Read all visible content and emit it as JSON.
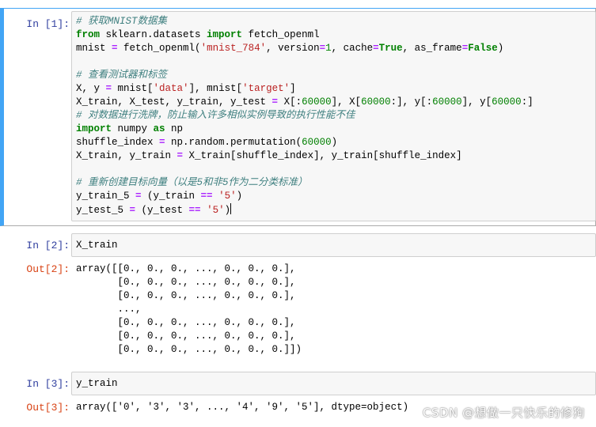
{
  "cells": [
    {
      "prompt": "In  [1]:",
      "lines": [
        [
          {
            "t": "cm",
            "v": "# 获取MNIST数据集"
          }
        ],
        [
          {
            "t": "kw",
            "v": "from"
          },
          {
            "t": "",
            "v": " sklearn.datasets "
          },
          {
            "t": "kw",
            "v": "import"
          },
          {
            "t": "",
            "v": " fetch_openml"
          }
        ],
        [
          {
            "t": "",
            "v": "mnist "
          },
          {
            "t": "op",
            "v": "="
          },
          {
            "t": "",
            "v": " fetch_openml("
          },
          {
            "t": "str",
            "v": "'mnist_784'"
          },
          {
            "t": "",
            "v": ", version"
          },
          {
            "t": "op",
            "v": "="
          },
          {
            "t": "num",
            "v": "1"
          },
          {
            "t": "",
            "v": ", cache"
          },
          {
            "t": "op",
            "v": "="
          },
          {
            "t": "kw",
            "v": "True"
          },
          {
            "t": "",
            "v": ", as_frame"
          },
          {
            "t": "op",
            "v": "="
          },
          {
            "t": "kw",
            "v": "False"
          },
          {
            "t": "",
            "v": ")"
          }
        ],
        [],
        [
          {
            "t": "cm",
            "v": "# 查看测试器和标签"
          }
        ],
        [
          {
            "t": "",
            "v": "X, y "
          },
          {
            "t": "op",
            "v": "="
          },
          {
            "t": "",
            "v": " mnist["
          },
          {
            "t": "str",
            "v": "'data'"
          },
          {
            "t": "",
            "v": "], mnist["
          },
          {
            "t": "str",
            "v": "'target'"
          },
          {
            "t": "",
            "v": "]"
          }
        ],
        [
          {
            "t": "",
            "v": "X_train, X_test, y_train, y_test "
          },
          {
            "t": "op",
            "v": "="
          },
          {
            "t": "",
            "v": " X[:"
          },
          {
            "t": "num",
            "v": "60000"
          },
          {
            "t": "",
            "v": "], X["
          },
          {
            "t": "num",
            "v": "60000"
          },
          {
            "t": "",
            "v": ":], y[:"
          },
          {
            "t": "num",
            "v": "60000"
          },
          {
            "t": "",
            "v": "], y["
          },
          {
            "t": "num",
            "v": "60000"
          },
          {
            "t": "",
            "v": ":]"
          }
        ],
        [
          {
            "t": "cm",
            "v": "# 对数据进行洗牌，防止输入许多相似实例导致的执行性能不佳"
          }
        ],
        [
          {
            "t": "kw",
            "v": "import"
          },
          {
            "t": "",
            "v": " numpy "
          },
          {
            "t": "kw",
            "v": "as"
          },
          {
            "t": "",
            "v": " np"
          }
        ],
        [
          {
            "t": "",
            "v": "shuffle_index "
          },
          {
            "t": "op",
            "v": "="
          },
          {
            "t": "",
            "v": " np.random.permutation("
          },
          {
            "t": "num",
            "v": "60000"
          },
          {
            "t": "",
            "v": ")"
          }
        ],
        [
          {
            "t": "",
            "v": "X_train, y_train "
          },
          {
            "t": "op",
            "v": "="
          },
          {
            "t": "",
            "v": " X_train[shuffle_index], y_train[shuffle_index]"
          }
        ],
        [],
        [
          {
            "t": "cm",
            "v": "# 重新创建目标向量（以是5和非5作为二分类标准）"
          }
        ],
        [
          {
            "t": "",
            "v": "y_train_5 "
          },
          {
            "t": "op",
            "v": "="
          },
          {
            "t": "",
            "v": " (y_train "
          },
          {
            "t": "op",
            "v": "=="
          },
          {
            "t": "",
            "v": " "
          },
          {
            "t": "str",
            "v": "'5'"
          },
          {
            "t": "",
            "v": ")"
          }
        ],
        [
          {
            "t": "",
            "v": "y_test_5 "
          },
          {
            "t": "op",
            "v": "="
          },
          {
            "t": "",
            "v": " (y_test "
          },
          {
            "t": "op",
            "v": "=="
          },
          {
            "t": "",
            "v": " "
          },
          {
            "t": "str",
            "v": "'5'"
          },
          {
            "t": "",
            "v": ")"
          }
        ]
      ]
    },
    {
      "prompt": "In  [2]:",
      "code": "X_train",
      "out_prompt": "Out[2]:",
      "output": "array([[0., 0., 0., ..., 0., 0., 0.],\n       [0., 0., 0., ..., 0., 0., 0.],\n       [0., 0., 0., ..., 0., 0., 0.],\n       ...,\n       [0., 0., 0., ..., 0., 0., 0.],\n       [0., 0., 0., ..., 0., 0., 0.],\n       [0., 0., 0., ..., 0., 0., 0.]])"
    },
    {
      "prompt": "In  [3]:",
      "code": "y_train",
      "out_prompt": "Out[3]:",
      "output": "array(['0', '3', '3', ..., '4', '9', '5'], dtype=object)"
    }
  ],
  "watermark": "CSDN @想做一只快乐的修狗",
  "colors": {
    "in_prompt": "#303f9f",
    "out_prompt": "#d84315",
    "selected_border": "#42a5f5",
    "comment": "#408080",
    "keyword": "#008000",
    "string": "#ba2121",
    "operator": "#aa22ff"
  }
}
